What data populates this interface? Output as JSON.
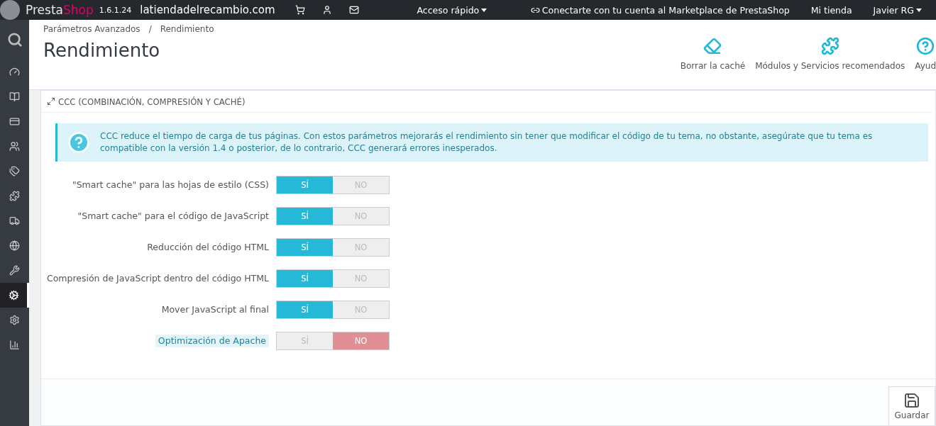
{
  "topbar": {
    "brand_a": "Presta",
    "brand_b": "Shop",
    "version": "1.6.1.24",
    "shop_domain": "latiendadelrecambio.com",
    "quick_access": "Acceso rápido",
    "marketplace": "Conectarte con tu cuenta al Marketplace de PrestaShop",
    "my_shop": "Mi tienda",
    "user": "Javier RG"
  },
  "sidebar": {
    "items": [
      {
        "kind": "dashboard",
        "selected": false
      },
      {
        "kind": "orders",
        "selected": false
      },
      {
        "kind": "payment",
        "selected": false
      },
      {
        "kind": "customers",
        "selected": false
      },
      {
        "kind": "tags",
        "selected": false
      },
      {
        "kind": "modules",
        "selected": false
      },
      {
        "kind": "shipping",
        "selected": false
      },
      {
        "kind": "localization",
        "selected": false
      },
      {
        "kind": "tools",
        "selected": false
      },
      {
        "kind": "advanced",
        "selected": true
      },
      {
        "kind": "settings",
        "selected": false
      },
      {
        "kind": "stats",
        "selected": false
      }
    ]
  },
  "breadcrumb": [
    "Parámetros Avanzados",
    "Rendimiento"
  ],
  "breadcrumb_separator": "/",
  "page_title": "Rendimiento",
  "toolbar": [
    {
      "kind": "eraser",
      "label": "Borrar la caché"
    },
    {
      "kind": "puzzle",
      "label": "Módulos y Servicios recomendados"
    },
    {
      "kind": "help",
      "label": "Ayud"
    }
  ],
  "panel": {
    "title": "CCC (COMBINACIÓN, COMPRESIÓN Y CACHÉ)",
    "alert": "CCC reduce el tiempo de carga de tus páginas. Con estos parámetros mejorarás el rendimiento sin tener que modificar el código de tu tema, no obstante, asegúrate que tu tema es compatible con la versión 1.4 o posterior, de lo contrario, CCC generará errores inesperados.",
    "settings": [
      {
        "kind": "plain",
        "label": "\"Smart cache\" para las hojas de estilo (CSS)",
        "options": [
          {
            "label": "SÍ",
            "selected": true
          },
          {
            "label": "NO",
            "selected": false
          }
        ]
      },
      {
        "kind": "plain",
        "label": "\"Smart cache\" para el código de JavaScript",
        "options": [
          {
            "label": "SÍ",
            "selected": true
          },
          {
            "label": "NO",
            "selected": false
          }
        ]
      },
      {
        "kind": "plain",
        "label": "Reducción del código HTML",
        "options": [
          {
            "label": "SÍ",
            "selected": true
          },
          {
            "label": "NO",
            "selected": false
          }
        ]
      },
      {
        "kind": "plain",
        "label": "Compresión de JavaScript dentro del código HTML",
        "options": [
          {
            "label": "SÍ",
            "selected": true
          },
          {
            "label": "NO",
            "selected": false
          }
        ]
      },
      {
        "kind": "plain",
        "label": "Mover JavaScript al final",
        "options": [
          {
            "label": "SÍ",
            "selected": true
          },
          {
            "label": "NO",
            "selected": false
          }
        ]
      },
      {
        "kind": "hint",
        "label": "Optimización de Apache",
        "options": [
          {
            "label": "SÍ",
            "selected": false
          },
          {
            "label": "NO",
            "selected": true
          }
        ]
      }
    ],
    "save": "Guardar"
  }
}
